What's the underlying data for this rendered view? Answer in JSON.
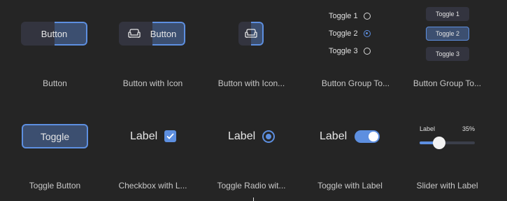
{
  "row1": {
    "button": {
      "label": "Button",
      "caption": "Button"
    },
    "button_icon": {
      "label": "Button",
      "icon": "sofa-icon",
      "caption": "Button with Icon"
    },
    "button_icon_only": {
      "icon": "sofa-icon",
      "caption": "Button with Icon..."
    },
    "radio_group": {
      "items": [
        {
          "label": "Toggle 1",
          "selected": false
        },
        {
          "label": "Toggle 2",
          "selected": true
        },
        {
          "label": "Toggle 3",
          "selected": false
        }
      ],
      "caption": "Button Group To..."
    },
    "button_group": {
      "items": [
        {
          "label": "Toggle 1",
          "selected": false
        },
        {
          "label": "Toggle 2",
          "selected": true
        },
        {
          "label": "Toggle 3",
          "selected": false
        }
      ],
      "caption": "Button Group To..."
    }
  },
  "row2": {
    "toggle_button": {
      "label": "Toggle",
      "caption": "Toggle Button"
    },
    "checkbox": {
      "label": "Label",
      "checked": true,
      "caption": "Checkbox with L..."
    },
    "radio": {
      "label": "Label",
      "selected": true,
      "caption": "Toggle Radio wit..."
    },
    "switch": {
      "label": "Label",
      "on": true,
      "caption": "Toggle with Label"
    },
    "slider": {
      "label": "Label",
      "value_text": "35%",
      "value": 0.35,
      "caption": "Slider with Label"
    }
  },
  "colors": {
    "background": "#252525",
    "accent": "#5d8fe0",
    "surface": "#33343f",
    "selected": "#3c4f70"
  }
}
